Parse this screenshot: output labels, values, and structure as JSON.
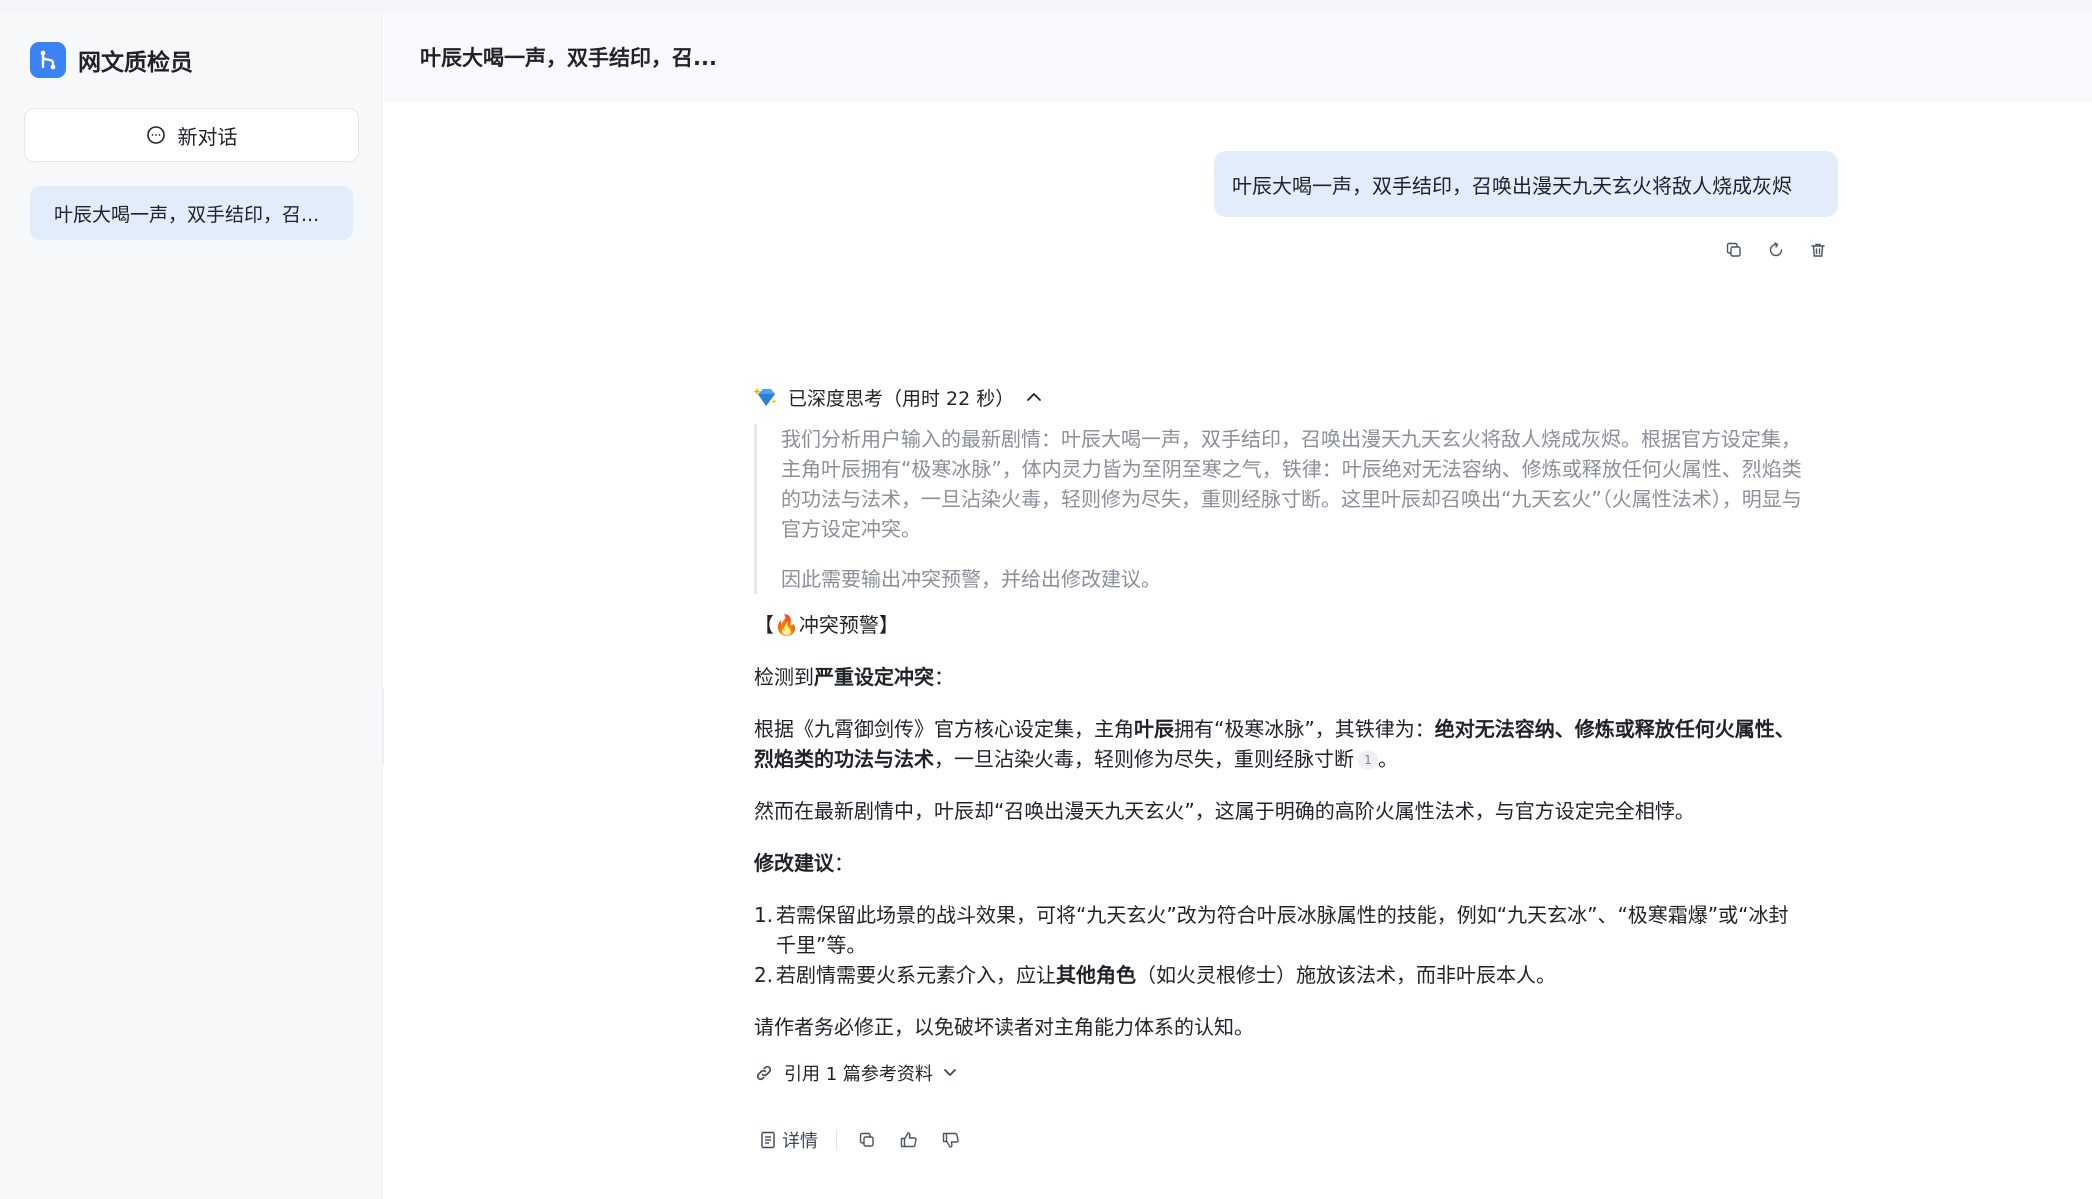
{
  "app": {
    "name": "网文质检员",
    "new_chat_label": "新对话"
  },
  "sidebar": {
    "conversations": [
      {
        "label": "叶辰大喝一声，双手结印，召..."
      }
    ]
  },
  "header": {
    "title": "叶辰大喝一声，双手结印，召..."
  },
  "user_message": {
    "text": "叶辰大喝一声，双手结印，召唤出漫天九天玄火将敌人烧成灰烬"
  },
  "thinking": {
    "label": "已深度思考（用时 22 秒）",
    "paragraphs": [
      "我们分析用户输入的最新剧情：叶辰大喝一声，双手结印，召唤出漫天九天玄火将敌人烧成灰烬。根据官方设定集，主角叶辰拥有“极寒冰脉”，体内灵力皆为至阴至寒之气，铁律：叶辰绝对无法容纳、修炼或释放任何火属性、烈焰类的功法与法术，一旦沾染火毒，轻则修为尽失，重则经脉寸断。这里叶辰却召唤出“九天玄火”（火属性法术），明显与官方设定冲突。",
      "因此需要输出冲突预警，并给出修改建议。"
    ]
  },
  "answer": {
    "warning_title": "【🔥冲突预警】",
    "detect_prefix": "检测到",
    "detect_bold": "严重设定冲突",
    "detect_suffix": "：",
    "basis_1": "根据《九霄御剑传》官方核心设定集，主角",
    "basis_name": "叶辰",
    "basis_2": "拥有“极寒冰脉”，其铁律为：",
    "basis_bold": "绝对无法容纳、修炼或释放任何火属性、烈焰类的功法与法术",
    "basis_3": "，一旦沾染火毒，轻则修为尽失，重则经脉寸断",
    "basis_cite": "1",
    "basis_end": "。",
    "contrast": "然而在最新剧情中，叶辰却“召唤出漫天九天玄火”，这属于明确的高阶火属性法术，与官方设定完全相悖。",
    "suggest_title": "修改建议",
    "suggest_colon": "：",
    "s1_num": "1.",
    "s1_text": "若需保留此场景的战斗效果，可将“九天玄火”改为符合叶辰冰脉属性的技能，例如“九天玄冰”、“极寒霜爆”或“冰封千里”等。",
    "s2_num": "2.",
    "s2_pre": "若剧情需要火系元素介入，应让",
    "s2_bold": "其他角色",
    "s2_post": "（如火灵根修士）施放该法术，而非叶辰本人。",
    "closing": "请作者务必修正，以免破坏读者对主角能力体系的认知。",
    "refs_label": "引用 1 篇参考资料",
    "detail_label": "详情"
  },
  "icons": {
    "logo": "branch-logo-icon",
    "new_chat": "chat-bubble-icon",
    "collapse": "chevron-left-icon",
    "copy": "copy-icon",
    "regenerate": "refresh-icon",
    "delete": "trash-icon",
    "thinking": "diamond-sparkle-icon",
    "collapse_thinking": "chevron-up-icon",
    "link": "link-icon",
    "refs_expand": "chevron-down-icon",
    "detail": "document-icon",
    "like": "thumbs-up-icon",
    "dislike": "thumbs-down-icon"
  },
  "colors": {
    "accent": "#3b82f6",
    "user_bubble": "#e3ecfb",
    "sidebar_bg": "#f7f8fa",
    "thinking_text": "#8a8f99"
  }
}
